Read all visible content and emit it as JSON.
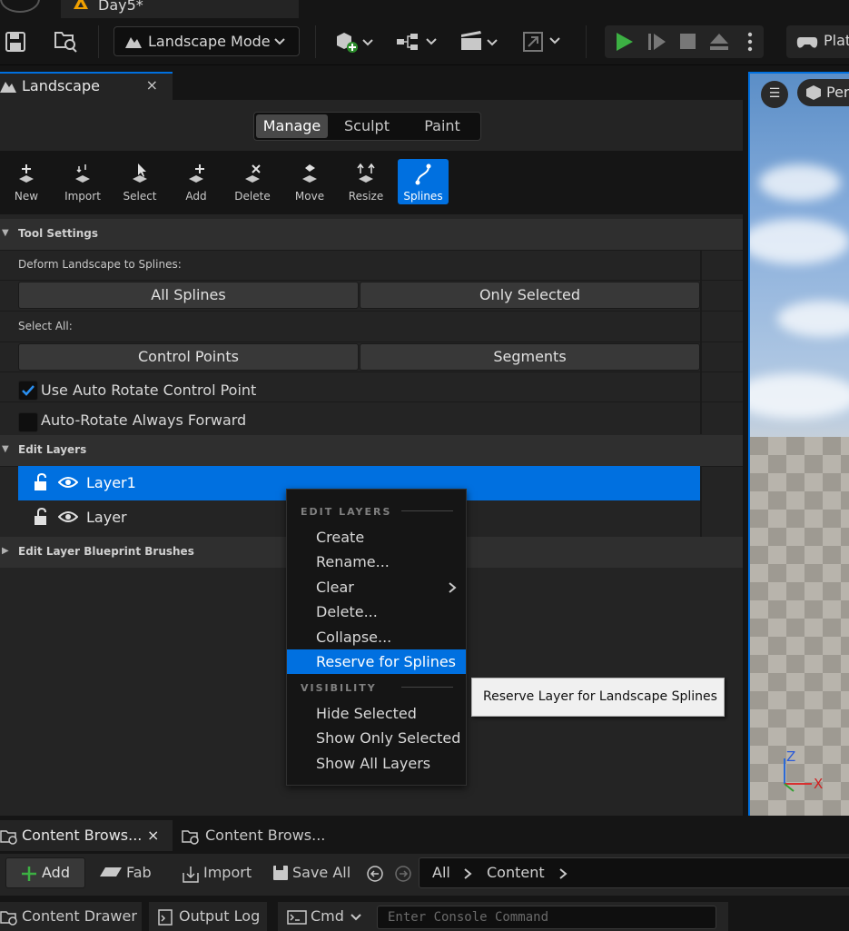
{
  "window": {
    "doc_tab": "Day5*"
  },
  "toolbar": {
    "mode_label": "Landscape Mode",
    "platforms_label": "Plat"
  },
  "landscape_panel": {
    "tab_label": "Landscape",
    "mode_tabs": [
      "Manage",
      "Sculpt",
      "Paint"
    ],
    "active_mode": "Manage",
    "tools": [
      {
        "label": "New",
        "icon": "new-icon"
      },
      {
        "label": "Import",
        "icon": "import-icon"
      },
      {
        "label": "Select",
        "icon": "select-icon"
      },
      {
        "label": "Add",
        "icon": "add-icon"
      },
      {
        "label": "Delete",
        "icon": "delete-icon"
      },
      {
        "label": "Move",
        "icon": "move-icon"
      },
      {
        "label": "Resize",
        "icon": "resize-icon"
      },
      {
        "label": "Splines",
        "icon": "splines-icon"
      }
    ],
    "active_tool": "Splines",
    "tool_settings": {
      "header": "Tool Settings",
      "deform_label": "Deform Landscape to Splines:",
      "all_splines": "All Splines",
      "only_selected": "Only Selected",
      "select_all_label": "Select All:",
      "control_points": "Control Points",
      "segments": "Segments",
      "auto_rotate_label": "Use Auto Rotate Control Point",
      "auto_rotate_checked": true,
      "always_forward_label": "Auto-Rotate Always Forward",
      "always_forward_checked": false
    },
    "edit_layers": {
      "header": "Edit Layers",
      "layers": [
        "Layer1",
        "Layer"
      ],
      "selected": "Layer1"
    },
    "blueprint_brushes_header": "Edit Layer Blueprint Brushes"
  },
  "context_menu": {
    "section1": "EDIT LAYERS",
    "items1": [
      "Create",
      "Rename...",
      "Clear",
      "Delete...",
      "Collapse...",
      "Reserve for Splines"
    ],
    "highlighted": "Reserve for Splines",
    "section2": "VISIBILITY",
    "items2": [
      "Hide Selected",
      "Show Only Selected",
      "Show All Layers"
    ]
  },
  "tooltip": "Reserve Layer for Landscape Splines",
  "viewport": {
    "perspective_label": "Per",
    "axis_z": "Z",
    "axis_x": "X"
  },
  "content_browser": {
    "tabs": [
      "Content Brows...",
      "Content Brows..."
    ],
    "add_label": "Add",
    "fab_label": "Fab",
    "import_label": "Import",
    "save_all_label": "Save All",
    "path": [
      "All",
      "Content"
    ]
  },
  "status_bar": {
    "content_drawer": "Content Drawer",
    "output_log": "Output Log",
    "cmd": "Cmd",
    "console_placeholder": "Enter Console Command"
  },
  "colors": {
    "accent": "#0070e0",
    "panel": "#242424",
    "dark": "#151515"
  }
}
